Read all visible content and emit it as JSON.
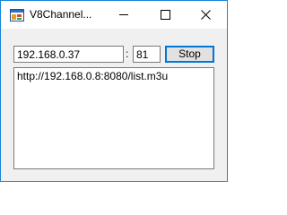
{
  "window": {
    "title": "V8Channel...",
    "accent_color": "#1883d7",
    "controls": {
      "minimize": "minimize-icon",
      "maximize": "maximize-icon",
      "close": "close-icon"
    }
  },
  "form": {
    "ip_value": "192.168.0.37",
    "separator": ":",
    "port_value": "81",
    "action_button_label": "Stop"
  },
  "list": {
    "items": [
      "http://192.168.0.8:8080/list.m3u"
    ]
  }
}
